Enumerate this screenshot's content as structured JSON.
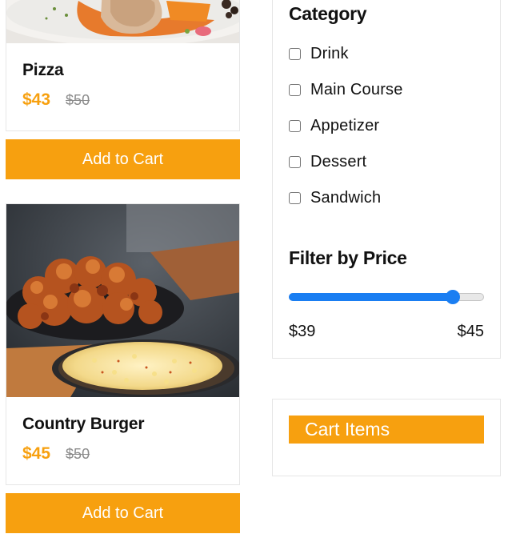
{
  "products": [
    {
      "name": "Pizza",
      "price": "$43",
      "old_price": "$50",
      "add_label": "Add to Cart",
      "image": "roast-dish-photo"
    },
    {
      "name": "Country Burger",
      "price": "$45",
      "old_price": "$50",
      "add_label": "Add to Cart",
      "image": "fried-chicken-corn-photo"
    }
  ],
  "filters": {
    "category_title": "Category",
    "categories": [
      {
        "label": "Drink",
        "checked": false
      },
      {
        "label": "Main Course",
        "checked": false
      },
      {
        "label": "Appetizer",
        "checked": false
      },
      {
        "label": "Dessert",
        "checked": false
      },
      {
        "label": "Sandwich",
        "checked": false
      }
    ],
    "price_title": "Filter by Price",
    "price_min": "$39",
    "price_max": "$45",
    "slider_fraction": 0.84
  },
  "cart": {
    "title": "Cart Items"
  },
  "colors": {
    "accent": "#f7a00f",
    "slider": "#1a7ef2",
    "old_price": "#8b8b8b"
  }
}
